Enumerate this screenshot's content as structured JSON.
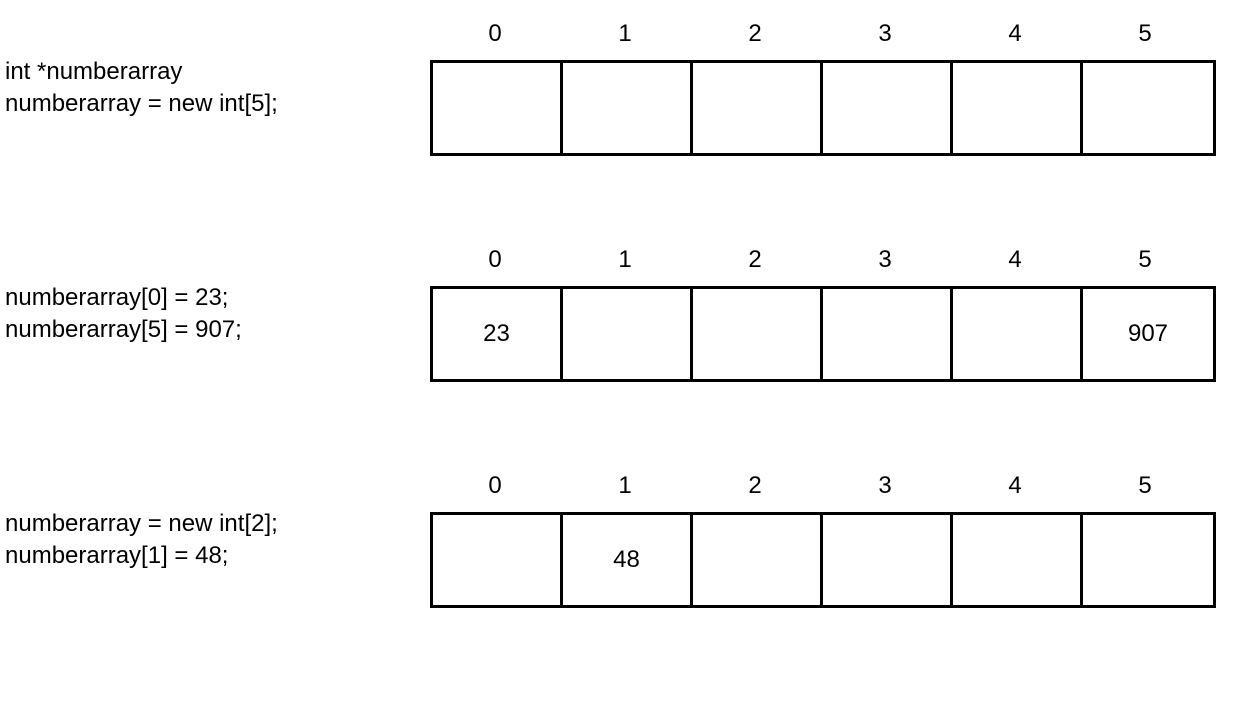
{
  "rows": [
    {
      "code": [
        "int *numberarray",
        "numberarray = new int[5];"
      ],
      "indices": [
        "0",
        "1",
        "2",
        "3",
        "4",
        "5"
      ],
      "cells": [
        "",
        "",
        "",
        "",
        "",
        ""
      ]
    },
    {
      "code": [
        "numberarray[0] = 23;",
        "numberarray[5] = 907;"
      ],
      "indices": [
        "0",
        "1",
        "2",
        "3",
        "4",
        "5"
      ],
      "cells": [
        "23",
        "",
        "",
        "",
        "",
        "907"
      ]
    },
    {
      "code": [
        "numberarray = new int[2];",
        "numberarray[1] = 48;"
      ],
      "indices": [
        "0",
        "1",
        "2",
        "3",
        "4",
        "5"
      ],
      "cells": [
        "",
        "48",
        "",
        "",
        "",
        ""
      ]
    }
  ]
}
